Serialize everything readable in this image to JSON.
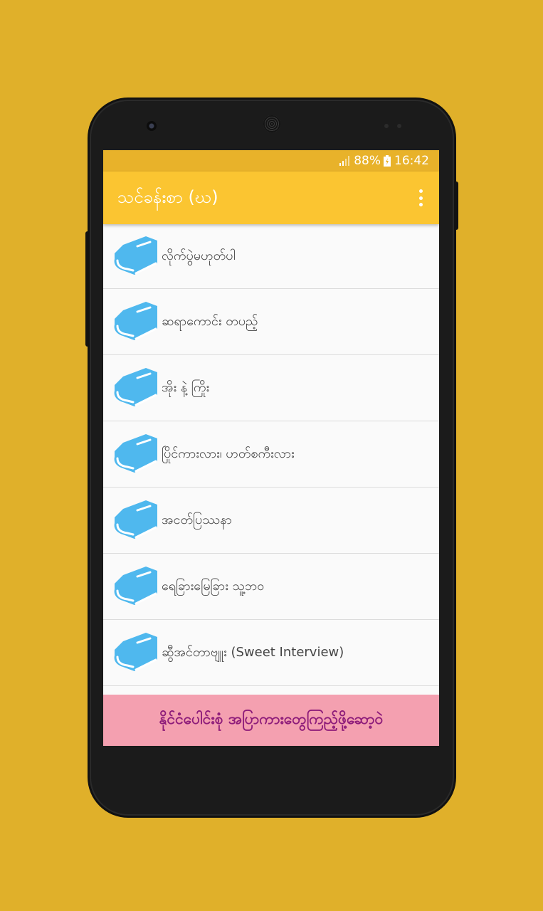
{
  "status_bar": {
    "battery_percent": "88%",
    "time": "16:42"
  },
  "app_bar": {
    "title": "သင်ခန်းစာ (ဃ)",
    "menu_icon": "more-vert-icon"
  },
  "lessons": [
    {
      "label": "လိုက်ပွဲမဟုတ်ပါ",
      "icon": "book-icon"
    },
    {
      "label": "ဆရာကောင်း တပည့်",
      "icon": "book-icon"
    },
    {
      "label": "အိုး နဲ့ ကြိုး",
      "icon": "book-icon"
    },
    {
      "label": "ပြိုင်ကားလား၊ ဟတ်စကီးလား",
      "icon": "book-icon"
    },
    {
      "label": "အငတ်ပြဿနာ",
      "icon": "book-icon"
    },
    {
      "label": "ရေခြားမြေခြား သူ့ဘဝ",
      "icon": "book-icon"
    },
    {
      "label": "ဆွီအင်တာဗျူး (Sweet Interview)",
      "icon": "book-icon"
    }
  ],
  "banner": {
    "text": "နိုင်ငံပေါင်းစုံ အပြာကားတွေကြည့်ဖို့ဆော့ဝဲ"
  },
  "colors": {
    "background": "#E0B02A",
    "app_bar": "#FBC531",
    "status_bar": "#E8B22A",
    "book_icon": "#4FB8EE",
    "banner_bg": "#F4A0B0",
    "banner_text": "#8E1C7A"
  }
}
